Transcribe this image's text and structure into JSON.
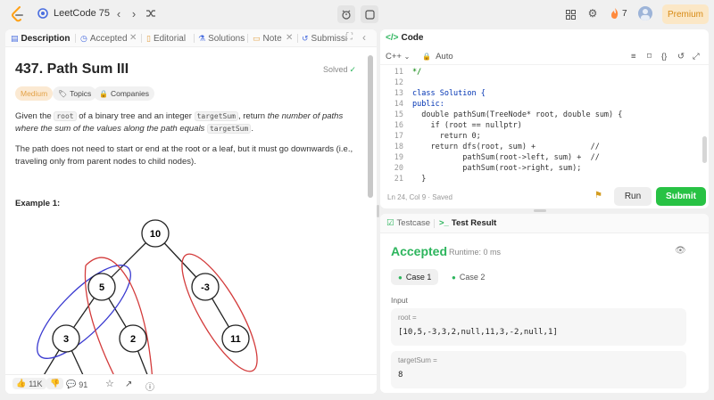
{
  "topbar": {
    "title": "LeetCode 75",
    "streak": "7",
    "premium": "Premium"
  },
  "left": {
    "tabs": [
      "Description",
      "Accepted",
      "Editorial",
      "Solutions",
      "Note",
      "Submissi"
    ],
    "title": "437. Path Sum III",
    "solved": "Solved",
    "tags": {
      "difficulty": "Medium",
      "topics": "Topics",
      "companies": "Companies"
    },
    "desc1_a": "Given the ",
    "desc1_root": "root",
    "desc1_b": " of a binary tree and an integer ",
    "desc1_target": "targetSum",
    "desc1_c": ", return ",
    "desc1_d": "the number of paths where the sum of the values along the path equals ",
    "desc1_target2": "targetSum",
    "desc1_e": ".",
    "desc2": "The path does not need to start or end at the root or a leaf, but it must go downwards (i.e., traveling only from parent nodes to child nodes).",
    "example": "Example 1:",
    "tree_nodes": [
      "10",
      "5",
      "-3",
      "3",
      "2",
      "11"
    ],
    "likes": "11K",
    "comments": "91"
  },
  "code": {
    "header": "Code",
    "language": "C++",
    "auto": "Auto",
    "lines": [
      {
        "n": "11",
        "t": "*/"
      },
      {
        "n": "12",
        "t": ""
      },
      {
        "n": "13",
        "t": "class Solution {"
      },
      {
        "n": "14",
        "t": "public:"
      },
      {
        "n": "15",
        "t": "  double pathSum(TreeNode* root, double sum) {"
      },
      {
        "n": "16",
        "t": "    if (root == nullptr)"
      },
      {
        "n": "17",
        "t": "      return 0;"
      },
      {
        "n": "18",
        "t": "    return dfs(root, sum) +            //"
      },
      {
        "n": "19",
        "t": "           pathSum(root->left, sum) +  //"
      },
      {
        "n": "20",
        "t": "           pathSum(root->right, sum);"
      },
      {
        "n": "21",
        "t": "  }"
      }
    ],
    "status": "Ln 24, Col 9  ·  Saved",
    "run": "Run",
    "submit": "Submit"
  },
  "result": {
    "tab_testcase": "Testcase",
    "tab_result": "Test Result",
    "accepted": "Accepted",
    "runtime": "Runtime: 0 ms",
    "case1": "Case 1",
    "case2": "Case 2",
    "input_label": "Input",
    "root_key": "root =",
    "root_val": "[10,5,-3,3,2,null,11,3,-2,null,1]",
    "target_key": "targetSum =",
    "target_val": "8"
  },
  "colors": {
    "accent_green": "#2db55d",
    "submit_green": "#28c244",
    "medium_orange": "#e3a247",
    "path_blue": "#3a3ad0",
    "path_red": "#d33b3b"
  }
}
